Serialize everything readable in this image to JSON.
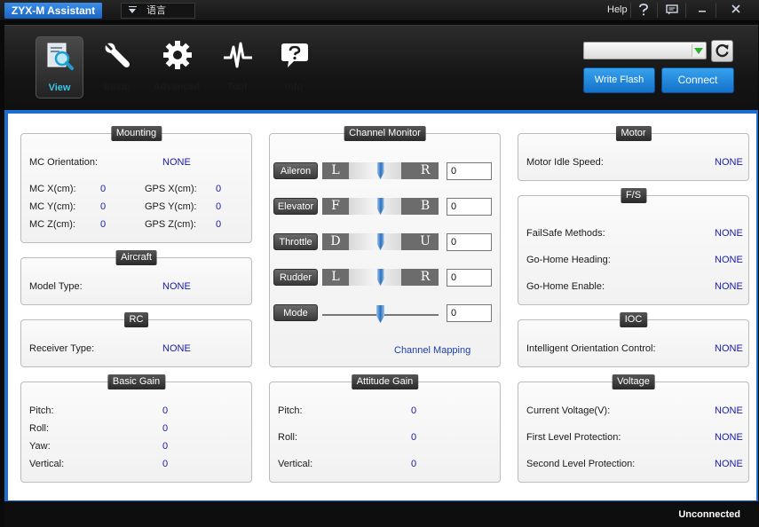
{
  "window": {
    "title": "ZYX-M Assistant",
    "language_label": "语言",
    "help_label": "Help",
    "help_icon": "question-mark-icon",
    "chat_icon": "message-icon",
    "minimize_icon": "minimize-icon",
    "close_icon": "close-icon"
  },
  "nav": [
    {
      "label": "View",
      "icon": "magnifier-document-icon",
      "active": true
    },
    {
      "label": "Basic",
      "icon": "wrench-icon"
    },
    {
      "label": "Advanced",
      "icon": "gear-icon"
    },
    {
      "label": "Tool",
      "icon": "pulse-icon"
    },
    {
      "label": "Info",
      "icon": "info-bubble-icon"
    }
  ],
  "toolbar": {
    "port_value": "",
    "write_flash_label": "Write Flash",
    "connect_label": "Connect"
  },
  "mounting": {
    "title": "Mounting",
    "orientation_label": "MC Orientation:",
    "orientation_value": "NONE",
    "mcx_label": "MC X(cm):",
    "mcx_value": "0",
    "mcy_label": "MC Y(cm):",
    "mcy_value": "0",
    "mcz_label": "MC Z(cm):",
    "mcz_value": "0",
    "gpsx_label": "GPS X(cm):",
    "gpsx_value": "0",
    "gpsy_label": "GPS Y(cm):",
    "gpsy_value": "0",
    "gpsz_label": "GPS Z(cm):",
    "gpsz_value": "0"
  },
  "aircraft": {
    "title": "Aircraft",
    "model_label": "Model Type:",
    "model_value": "NONE"
  },
  "rc": {
    "title": "RC",
    "receiver_label": "Receiver Type:",
    "receiver_value": "NONE"
  },
  "basic_gain": {
    "title": "Basic Gain",
    "pitch_label": "Pitch:",
    "pitch_value": "0",
    "roll_label": "Roll:",
    "roll_value": "0",
    "yaw_label": "Yaw:",
    "yaw_value": "0",
    "vertical_label": "Vertical:",
    "vertical_value": "0"
  },
  "channel_monitor": {
    "title": "Channel Monitor",
    "channels": [
      {
        "name": "Aileron",
        "left": "L",
        "right": "R",
        "value": "0",
        "position": 0.5
      },
      {
        "name": "Elevator",
        "left": "F",
        "right": "B",
        "value": "0",
        "position": 0.5
      },
      {
        "name": "Throttle",
        "left": "D",
        "right": "U",
        "value": "0",
        "position": 0.5
      },
      {
        "name": "Rudder",
        "left": "L",
        "right": "R",
        "value": "0",
        "position": 0.5
      }
    ],
    "mode": {
      "name": "Mode",
      "value": "0",
      "position": 0.5
    },
    "mapping_link": "Channel Mapping"
  },
  "attitude_gain": {
    "title": "Attitude Gain",
    "pitch_label": "Pitch:",
    "pitch_value": "0",
    "roll_label": "Roll:",
    "roll_value": "0",
    "vertical_label": "Vertical:",
    "vertical_value": "0"
  },
  "motor": {
    "title": "Motor",
    "idle_label": "Motor Idle Speed:",
    "idle_value": "NONE"
  },
  "failsafe": {
    "title": "F/S",
    "methods_label": "FailSafe Methods:",
    "methods_value": "NONE",
    "heading_label": "Go-Home Heading:",
    "heading_value": "NONE",
    "enable_label": "Go-Home Enable:",
    "enable_value": "NONE"
  },
  "ioc": {
    "title": "IOC",
    "control_label": "Intelligent Orientation Control:",
    "control_value": "NONE"
  },
  "voltage": {
    "title": "Voltage",
    "current_label": "Current Voltage(V):",
    "current_value": "NONE",
    "first_label": "First Level Protection:",
    "first_value": "NONE",
    "second_label": "Second Level Protection:",
    "second_value": "NONE"
  },
  "status": {
    "text": "Unconnected"
  },
  "colors": {
    "accent_blue": "#1c6fd0",
    "value_blue": "#1a1aa8",
    "active_nav": "#39c7e8"
  }
}
